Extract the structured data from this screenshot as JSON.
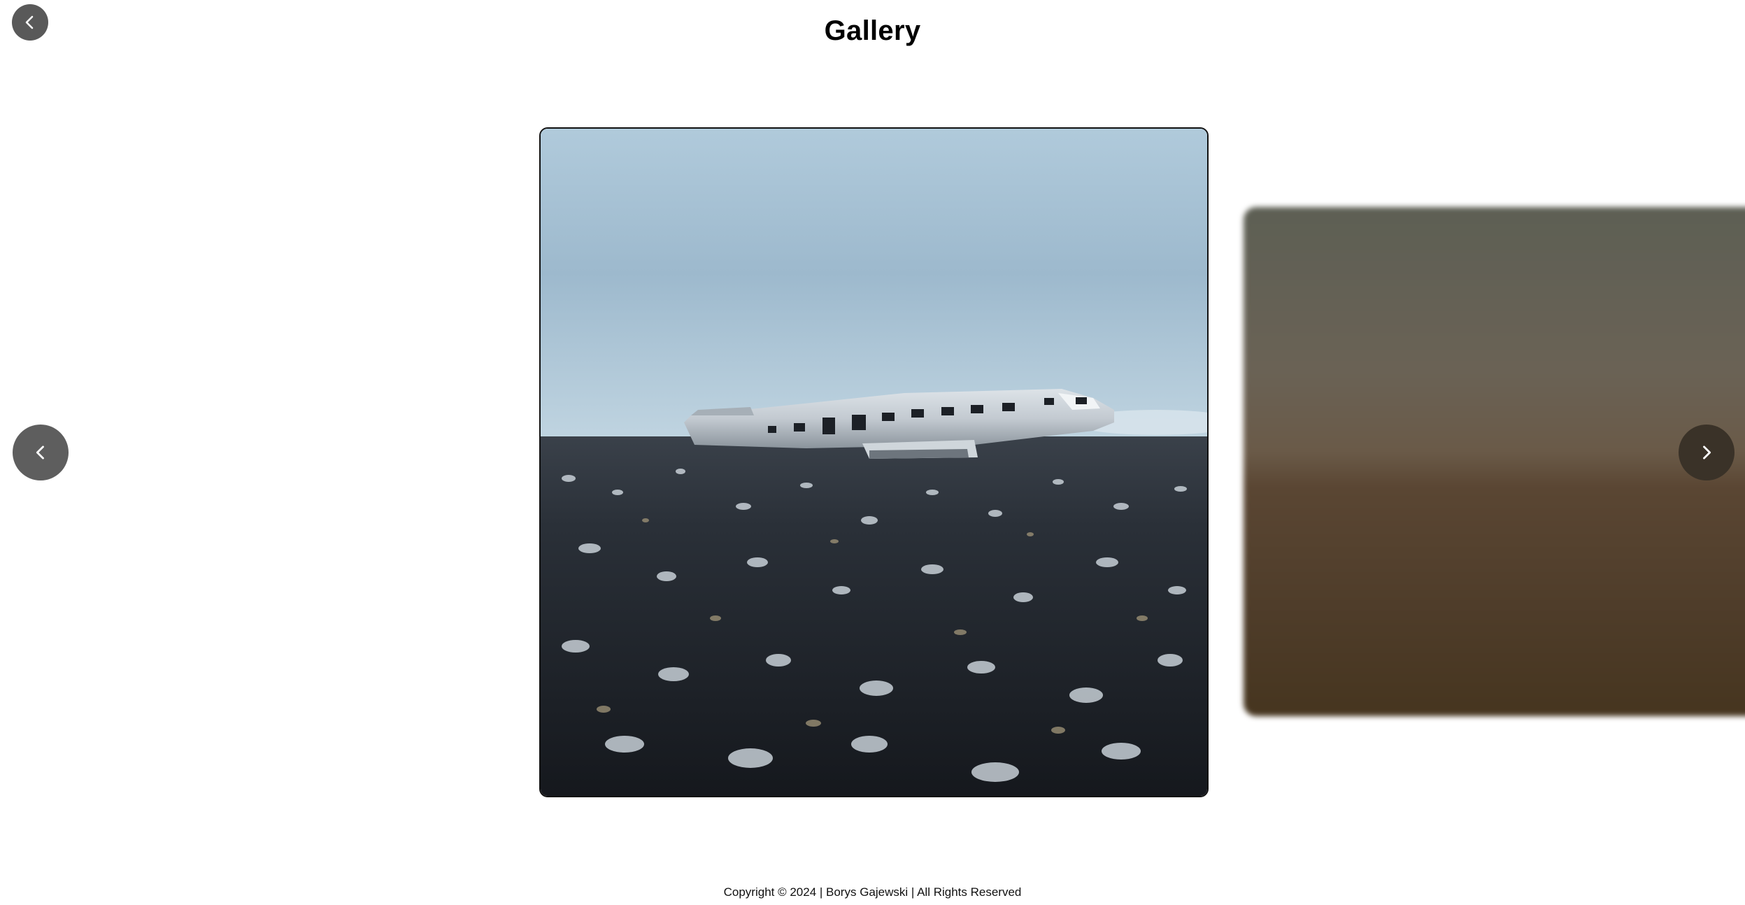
{
  "header": {
    "title": "Gallery",
    "back_icon": "chevron-left-icon"
  },
  "carousel": {
    "prev_icon": "chevron-left-icon",
    "next_icon": "chevron-right-icon",
    "current_image": "wrecked airplane on black pebble beach",
    "next_image": "blurred preview"
  },
  "footer": {
    "text": "Copyright © 2024 | Borys Gajewski | All Rights Reserved"
  }
}
